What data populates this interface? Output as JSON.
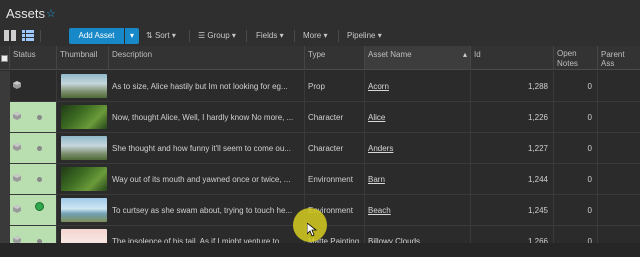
{
  "header": {
    "title": "Assets",
    "favorite_icon": "star-icon"
  },
  "toolbar": {
    "view_icons": [
      "grid-view-icon",
      "list-view-icon"
    ],
    "add_label": "Add Asset",
    "add_caret": "▾",
    "menus": [
      {
        "icon": "sort-icon",
        "label": "Sort",
        "caret": "▾"
      },
      {
        "icon": "group-icon",
        "label": "Group",
        "caret": "▾"
      },
      {
        "label": "Fields",
        "caret": "▾"
      },
      {
        "label": "More",
        "caret": "▾"
      },
      {
        "label": "Pipeline",
        "caret": "▾"
      }
    ]
  },
  "table": {
    "columns": [
      "Status",
      "Thumbnail",
      "Description",
      "Type",
      "Asset Name",
      "Id",
      "Open Notes",
      "Parent Ass"
    ],
    "open_notes_line1": "Open",
    "open_notes_line2": "Notes",
    "rows": [
      {
        "description": "As to size, Alice hastily but Im not looking for eg...",
        "type": "Prop",
        "name": "Acorn",
        "id": "1,288",
        "notes": "0",
        "status": "none",
        "thumb": "rabbit"
      },
      {
        "description": "Now, thought Alice, Well, I hardly know No more, ...",
        "type": "Character",
        "name": "Alice",
        "id": "1,226",
        "notes": "0",
        "status": "dot",
        "thumb": "forest"
      },
      {
        "description": "She thought and how funny it'll seem to come ou...",
        "type": "Character",
        "name": "Anders",
        "id": "1,227",
        "notes": "0",
        "status": "dot",
        "thumb": "rabbit"
      },
      {
        "description": "Way out of its mouth and yawned once or twice, ...",
        "type": "Environment",
        "name": "Barn",
        "id": "1,244",
        "notes": "0",
        "status": "dot",
        "thumb": "forest"
      },
      {
        "description": "To curtsey as she swam about, trying to touch he...",
        "type": "Environment",
        "name": "Beach",
        "id": "1,245",
        "notes": "0",
        "status": "green",
        "thumb": "beach"
      },
      {
        "description": "The insolence of his tail. As if I might venture to ...",
        "type": "Matte Painting",
        "name": "Billowy Clouds",
        "id": "1,266",
        "notes": "0",
        "status": "dot",
        "thumb": "clouds"
      }
    ]
  },
  "colors": {
    "accent": "#1788c8",
    "status_green": "#2ea84a",
    "cursor_highlight": "#d6cd1e"
  }
}
